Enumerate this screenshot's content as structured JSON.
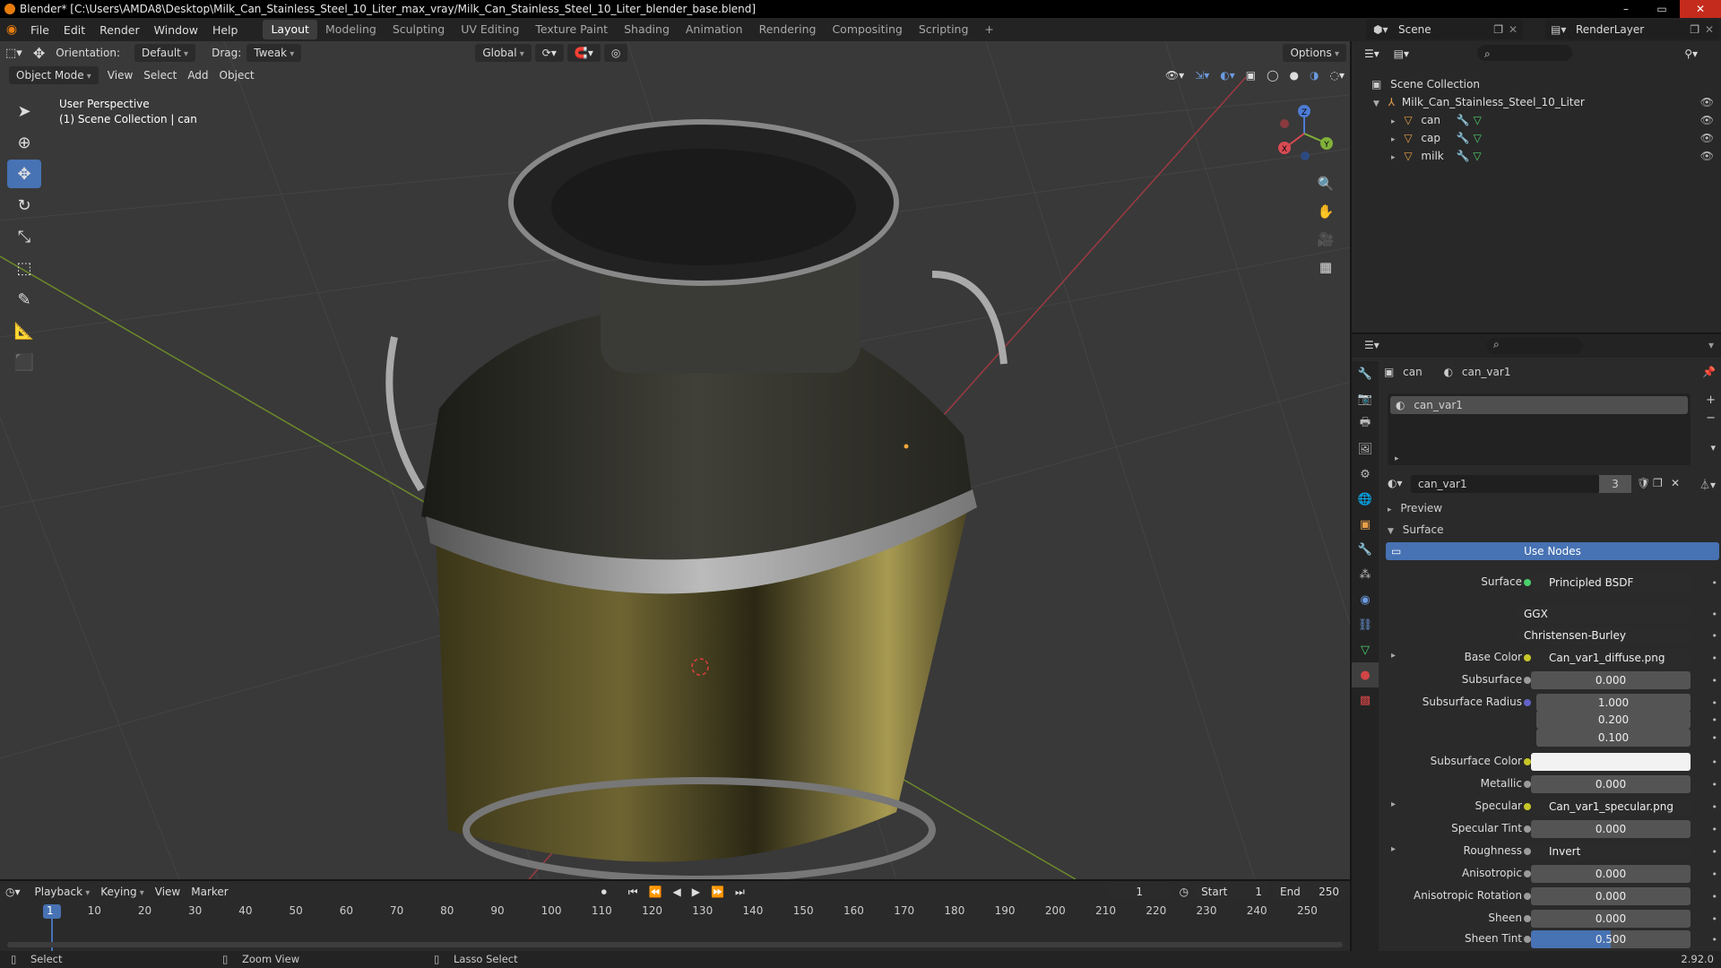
{
  "title_bar": {
    "text": "Blender* [C:\\Users\\AMDA8\\Desktop\\Milk_Can_Stainless_Steel_10_Liter_max_vray/Milk_Can_Stainless_Steel_10_Liter_blender_base.blend]",
    "minimize": "–",
    "maximize": "▭",
    "close": "✕"
  },
  "menu": [
    "File",
    "Edit",
    "Render",
    "Window",
    "Help"
  ],
  "workspaces": [
    "Layout",
    "Modeling",
    "Sculpting",
    "UV Editing",
    "Texture Paint",
    "Shading",
    "Animation",
    "Rendering",
    "Compositing",
    "Scripting",
    "+"
  ],
  "scene": "Scene",
  "render_layer": "RenderLayer",
  "viewport": {
    "orientation_label": "Orientation:",
    "orientation_value": "Default",
    "drag_label": "Drag:",
    "drag_value": "Tweak",
    "transform_space": "Global",
    "options": "Options",
    "mode": "Object Mode",
    "menus": [
      "View",
      "Select",
      "Add",
      "Object"
    ],
    "info_line1": "User Perspective",
    "info_line2": "(1) Scene Collection | can",
    "gizmo": {
      "x": "X",
      "y": "Y",
      "z": "Z"
    }
  },
  "toolbar_icons": [
    "select-box-icon",
    "cursor-icon",
    "move-icon",
    "rotate-icon",
    "scale-icon",
    "transform-icon",
    "annotate-icon",
    "measure-icon",
    "add-cube-icon"
  ],
  "outliner": {
    "root": "Scene Collection",
    "collection": "Milk_Can_Stainless_Steel_10_Liter",
    "objects": [
      "can",
      "cap",
      "milk"
    ]
  },
  "properties": {
    "object": "can",
    "material": "can_var1",
    "slot": "can_var1",
    "material_name": "can_var1",
    "users": "3",
    "preview": "Preview",
    "surface_panel": "Surface",
    "use_nodes": "Use Nodes",
    "rows": [
      {
        "label": "Surface",
        "value": "Principled BSDF",
        "kind": "link"
      },
      {
        "label": "",
        "value": "GGX",
        "kind": "enum"
      },
      {
        "label": "",
        "value": "Christensen-Burley",
        "kind": "enum"
      },
      {
        "label": "Base Color",
        "value": "Can_var1_diffuse.png",
        "kind": "link"
      },
      {
        "label": "Subsurface",
        "value": "0.000",
        "kind": "num"
      },
      {
        "label": "Subsurface Radius",
        "value": "1.000",
        "kind": "num"
      },
      {
        "label": "",
        "value": "0.200",
        "kind": "num"
      },
      {
        "label": "",
        "value": "0.100",
        "kind": "num"
      },
      {
        "label": "Subsurface Color",
        "value": "",
        "kind": "color"
      },
      {
        "label": "Metallic",
        "value": "0.000",
        "kind": "num"
      },
      {
        "label": "Specular",
        "value": "Can_var1_specular.png",
        "kind": "link"
      },
      {
        "label": "Specular Tint",
        "value": "0.000",
        "kind": "num"
      },
      {
        "label": "Roughness",
        "value": "Invert",
        "kind": "link"
      },
      {
        "label": "Anisotropic",
        "value": "0.000",
        "kind": "num"
      },
      {
        "label": "Anisotropic Rotation",
        "value": "0.000",
        "kind": "num"
      },
      {
        "label": "Sheen",
        "value": "0.000",
        "kind": "num"
      },
      {
        "label": "Sheen Tint",
        "value": "0.500",
        "kind": "num"
      }
    ]
  },
  "timeline": {
    "menus": [
      "Playback",
      "Keying",
      "View",
      "Marker"
    ],
    "current_frame": "1",
    "start_label": "Start",
    "start": "1",
    "end_label": "End",
    "end": "250",
    "ticks": [
      "1",
      "10",
      "20",
      "30",
      "40",
      "50",
      "60",
      "70",
      "80",
      "90",
      "100",
      "110",
      "120",
      "130",
      "140",
      "150",
      "160",
      "170",
      "180",
      "190",
      "200",
      "210",
      "220",
      "230",
      "240",
      "250"
    ]
  },
  "statusbar": {
    "select": "Select",
    "zoom": "Zoom View",
    "lasso": "Lasso Select",
    "version": "2.92.0"
  },
  "colors": {
    "accent": "#4772b3",
    "active_frame": "#4772b3",
    "header": "#232323",
    "viewport_bg": "#393939"
  }
}
